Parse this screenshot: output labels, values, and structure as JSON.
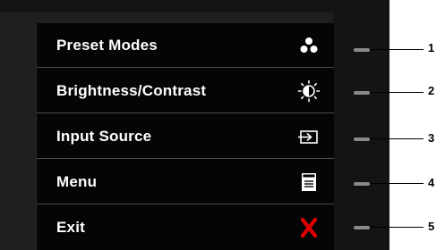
{
  "menu": {
    "items": [
      {
        "label": "Preset Modes",
        "icon": "preset-modes-icon",
        "number": "1"
      },
      {
        "label": "Brightness/Contrast",
        "icon": "brightness-contrast-icon",
        "number": "2"
      },
      {
        "label": "Input Source",
        "icon": "input-source-icon",
        "number": "3"
      },
      {
        "label": "Menu",
        "icon": "menu-icon",
        "number": "4"
      },
      {
        "label": "Exit",
        "icon": "exit-icon",
        "number": "5"
      }
    ]
  },
  "colors": {
    "osd_background": "#050505",
    "text": "#ffffff",
    "exit_icon": "#e00000",
    "button": "#8a8a8a"
  }
}
